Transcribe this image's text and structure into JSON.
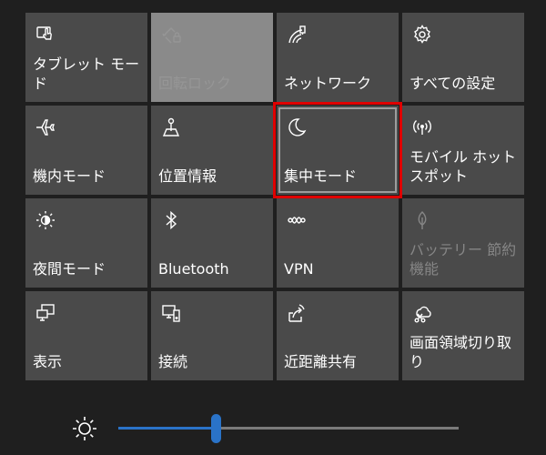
{
  "tiles": [
    {
      "label": "タブレット モード",
      "icon": "tablet-mode-icon",
      "state": "normal"
    },
    {
      "label": "回転ロック",
      "icon": "rotation-lock-icon",
      "state": "pressed-disabled"
    },
    {
      "label": "ネットワーク",
      "icon": "network-icon",
      "state": "normal"
    },
    {
      "label": "すべての設定",
      "icon": "settings-gear-icon",
      "state": "normal"
    },
    {
      "label": "機内モード",
      "icon": "airplane-icon",
      "state": "normal"
    },
    {
      "label": "位置情報",
      "icon": "location-icon",
      "state": "normal"
    },
    {
      "label": "集中モード",
      "icon": "moon-icon",
      "state": "focused"
    },
    {
      "label": "モバイル ホットスポット",
      "icon": "hotspot-icon",
      "state": "normal"
    },
    {
      "label": "夜間モード",
      "icon": "night-light-icon",
      "state": "normal"
    },
    {
      "label": "Bluetooth",
      "icon": "bluetooth-icon",
      "state": "normal"
    },
    {
      "label": "VPN",
      "icon": "vpn-icon",
      "state": "normal"
    },
    {
      "label": "バッテリー 節約機能",
      "icon": "battery-saver-icon",
      "state": "disabled"
    },
    {
      "label": "表示",
      "icon": "project-display-icon",
      "state": "normal"
    },
    {
      "label": "接続",
      "icon": "connect-icon",
      "state": "normal"
    },
    {
      "label": "近距離共有",
      "icon": "nearby-share-icon",
      "state": "normal"
    },
    {
      "label": "画面領域切り取り",
      "icon": "screen-snip-icon",
      "state": "normal"
    }
  ],
  "brightness": {
    "icon": "brightness-sun-icon",
    "level_fraction": 0.29,
    "accent_color": "#2a73c8"
  },
  "highlight": {
    "color": "#e00000"
  }
}
